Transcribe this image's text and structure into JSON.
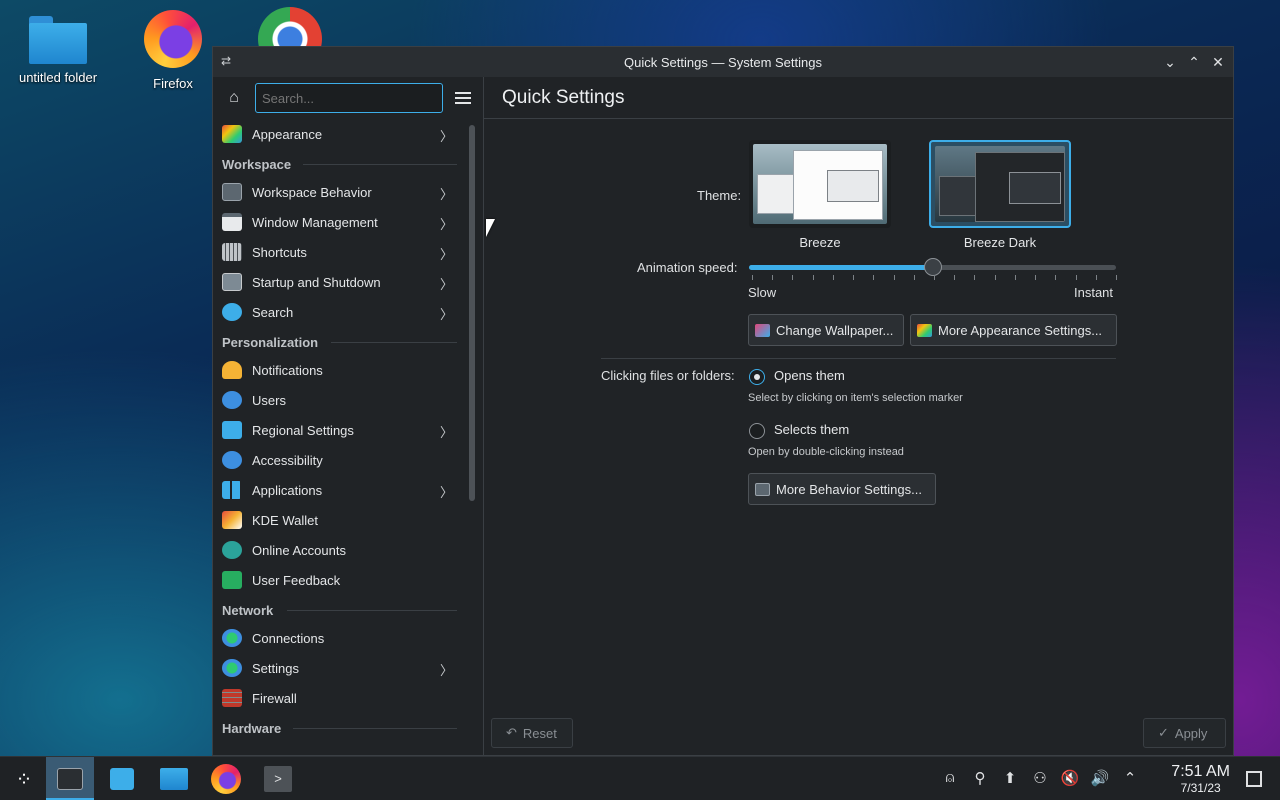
{
  "desktop": {
    "icons": [
      {
        "label": "untitled folder",
        "icon": "folder-icon"
      },
      {
        "label": "Firefox",
        "icon": "firefox-icon"
      },
      {
        "label": "",
        "icon": "chrome-icon"
      }
    ]
  },
  "window": {
    "title": "Quick Settings — System Settings",
    "controls": {
      "minimize": "⌄",
      "maximize": "⌃",
      "close": "✕"
    }
  },
  "sidebar": {
    "search_placeholder": "Search...",
    "top_item": {
      "label": "Appearance",
      "has_arrow": true
    },
    "categories": [
      {
        "name": "Workspace",
        "items": [
          {
            "label": "Workspace Behavior",
            "has_arrow": true
          },
          {
            "label": "Window Management",
            "has_arrow": true
          },
          {
            "label": "Shortcuts",
            "has_arrow": true
          },
          {
            "label": "Startup and Shutdown",
            "has_arrow": true
          },
          {
            "label": "Search",
            "has_arrow": true
          }
        ]
      },
      {
        "name": "Personalization",
        "items": [
          {
            "label": "Notifications",
            "has_arrow": false
          },
          {
            "label": "Users",
            "has_arrow": false
          },
          {
            "label": "Regional Settings",
            "has_arrow": true
          },
          {
            "label": "Accessibility",
            "has_arrow": false
          },
          {
            "label": "Applications",
            "has_arrow": true
          },
          {
            "label": "KDE Wallet",
            "has_arrow": false
          },
          {
            "label": "Online Accounts",
            "has_arrow": false
          },
          {
            "label": "User Feedback",
            "has_arrow": false
          }
        ]
      },
      {
        "name": "Network",
        "items": [
          {
            "label": "Connections",
            "has_arrow": false
          },
          {
            "label": "Settings",
            "has_arrow": true
          },
          {
            "label": "Firewall",
            "has_arrow": false
          }
        ]
      },
      {
        "name": "Hardware",
        "items": []
      }
    ]
  },
  "main": {
    "page_title": "Quick Settings",
    "theme_label": "Theme:",
    "themes": [
      {
        "name": "Breeze",
        "selected": false
      },
      {
        "name": "Breeze Dark",
        "selected": true
      }
    ],
    "animation_label": "Animation speed:",
    "animation_speed_fraction": 0.5,
    "slider_min": "Slow",
    "slider_max": "Instant",
    "change_wallpaper": "Change Wallpaper...",
    "more_appearance": "More Appearance Settings...",
    "clicking_label": "Clicking files or folders:",
    "opens_them": "Opens them",
    "opens_desc": "Select by clicking on item's selection marker",
    "selects_them": "Selects them",
    "selects_desc": "Open by double-clicking instead",
    "more_behavior": "More Behavior Settings...",
    "reset": "Reset",
    "apply": "Apply"
  },
  "taskbar": {
    "time": "7:51 AM",
    "date": "7/31/23"
  },
  "colors": {
    "accent": "#3daee9",
    "window_bg": "#202326",
    "panel_bg": "#1f2225"
  }
}
